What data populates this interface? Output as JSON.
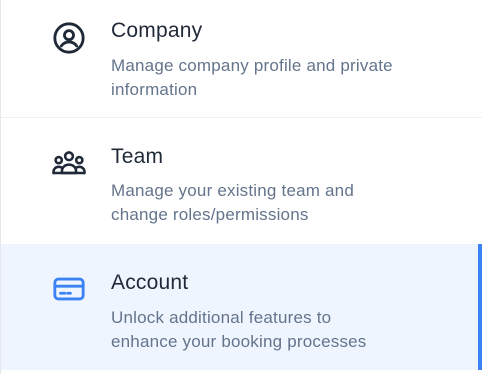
{
  "nav": {
    "items": [
      {
        "title": "Company",
        "description_line1": "Manage company profile and private",
        "description_line2": "information",
        "icon": "user-circle-icon",
        "active": false
      },
      {
        "title": "Team",
        "description_line1": "Manage your existing team and",
        "description_line2": "change roles/permissions",
        "icon": "users-group-icon",
        "active": false
      },
      {
        "title": "Account",
        "description_line1": "Unlock additional features to",
        "description_line2": "enhance your booking processes",
        "icon": "credit-card-icon",
        "active": true
      }
    ]
  },
  "colors": {
    "active_background": "#eef5ff",
    "active_indicator": "#3b82f6",
    "title_text": "#1f2937",
    "description_text": "#64748b",
    "icon_default": "#1f2937",
    "icon_active": "#3b82f6"
  }
}
